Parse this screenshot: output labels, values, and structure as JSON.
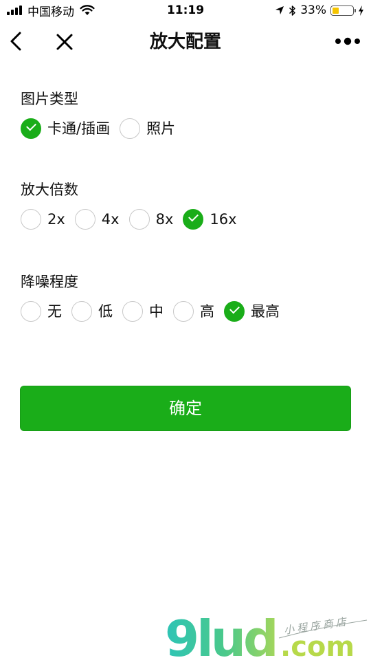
{
  "status_bar": {
    "carrier": "中国移动",
    "time": "11:19",
    "battery": "33%",
    "battery_level": 0.33
  },
  "nav": {
    "title": "放大配置",
    "icons": [
      "chevron-left-icon",
      "close-icon",
      "more-icon"
    ]
  },
  "form": {
    "image_type": {
      "label": "图片类型",
      "options": [
        {
          "label": "卡通/插画",
          "checked": true
        },
        {
          "label": "照片",
          "checked": false
        }
      ]
    },
    "scale": {
      "label": "放大倍数",
      "options": [
        {
          "label": "2x",
          "checked": false
        },
        {
          "label": "4x",
          "checked": false
        },
        {
          "label": "8x",
          "checked": false
        },
        {
          "label": "16x",
          "checked": true
        }
      ]
    },
    "denoise": {
      "label": "降噪程度",
      "options": [
        {
          "label": "无",
          "checked": false
        },
        {
          "label": "低",
          "checked": false
        },
        {
          "label": "中",
          "checked": false
        },
        {
          "label": "高",
          "checked": false
        },
        {
          "label": "最高",
          "checked": true
        }
      ]
    },
    "confirm_label": "确定"
  },
  "watermark": {
    "brand": "9lud",
    "domain": ".com",
    "tagline": "小程序商店"
  },
  "colors": {
    "accent": "#1aad19",
    "battery_fill": "#f5c400"
  }
}
